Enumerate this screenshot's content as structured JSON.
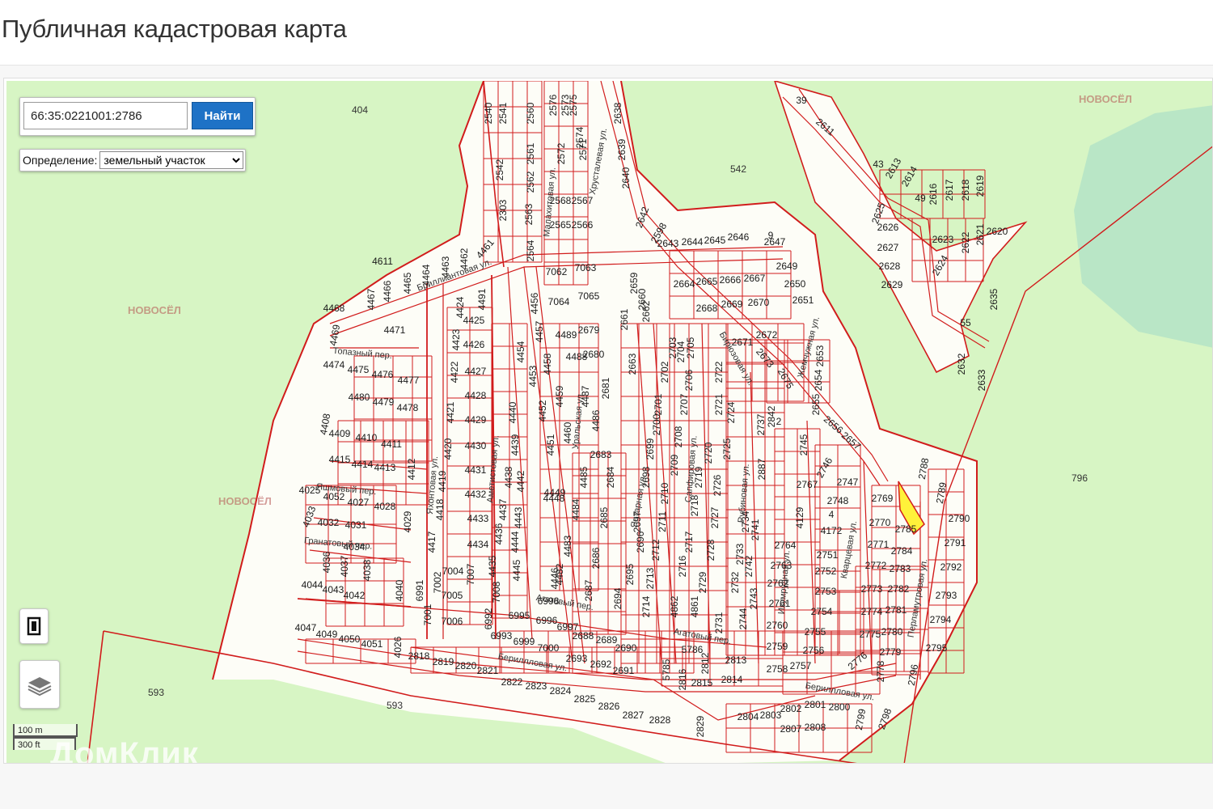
{
  "page": {
    "title": "Публичная кадастровая карта"
  },
  "search": {
    "value": "66:35:0221001:2786",
    "button_label": "Найти"
  },
  "definition": {
    "label": "Определение:",
    "selected": "земельный участок"
  },
  "scale": {
    "metric": "100 m",
    "imperial": "300 ft"
  },
  "watermarks": {
    "domclick": "ДомКлик",
    "novosel": "НОВОСЁЛ"
  },
  "colors": {
    "boundary": "#d11c1c",
    "land": "#d7f5c4",
    "built_area": "#ffffff",
    "selected_parcel": "#fff23a",
    "button": "#1e72c6"
  },
  "icons": {
    "fullscreen": "fullscreen-icon",
    "layers": "layers-icon",
    "search": "search-button"
  },
  "map": {
    "area_labels": [
      "404",
      "542",
      "796",
      "593",
      "593"
    ],
    "street_labels": [
      "Бриллиантовая ул.",
      "Топазный пер.",
      "Яшмовый пер.",
      "Гранатовый пер.",
      "Агатовый пер.",
      "Агатовый пер.",
      "Бериллловая ул.",
      "Бериллловая ул.",
      "Бирюзовая ул.",
      "Кварцевая ул.",
      "Перламутровая ул.",
      "Жемчужная ул.",
      "Хрусталевая ул.",
      "Малахитовая ул.",
      "Янтарная ул.",
      "Сапфировая ул.",
      "Рубиновая ул.",
      "Аметистовая ул.",
      "Яхонтовая ул.",
      "Уральская ул.",
      "Изумрудная ул."
    ],
    "selected_parcel": "2786",
    "parcels": [
      "2540",
      "2541",
      "2542",
      "2303",
      "2560",
      "2561",
      "2562",
      "2563",
      "2564",
      "2576",
      "2573",
      "2572",
      "2575",
      "2574",
      "2571",
      "2568",
      "2567",
      "2565",
      "2566",
      "2638",
      "2639",
      "2640",
      "2642",
      "2598",
      "2643",
      "2644",
      "2645",
      "2646",
      "2647",
      "2649",
      "2650",
      "2651",
      "2664",
      "2665",
      "2666",
      "2667",
      "2668",
      "2669",
      "2670",
      "2671",
      "2672",
      "2673",
      "2675",
      "2653",
      "2654",
      "2655",
      "2656",
      "2657",
      "2659",
      "2660",
      "2661",
      "2662",
      "2663",
      "2679",
      "2680",
      "2681",
      "2683",
      "2684",
      "2685",
      "2686",
      "2687",
      "2688",
      "2689",
      "2690",
      "2691",
      "2692",
      "2693",
      "2694",
      "2695",
      "2696",
      "2697",
      "2698",
      "2699",
      "2700",
      "2701",
      "2702",
      "2703",
      "2704",
      "2705",
      "2706",
      "2707",
      "2708",
      "2709",
      "2710",
      "2711",
      "2712",
      "2713",
      "2714",
      "2716",
      "2717",
      "2718",
      "2719",
      "2720",
      "2721",
      "2722",
      "2724",
      "2725",
      "2726",
      "2727",
      "2728",
      "2729",
      "2731",
      "2732",
      "2733",
      "2734",
      "2737",
      "2741",
      "2742",
      "2743",
      "2744",
      "2745",
      "2746",
      "2747",
      "2748",
      "2751",
      "2752",
      "2753",
      "2754",
      "2755",
      "2756",
      "2757",
      "2758",
      "2759",
      "2760",
      "2761",
      "2762",
      "2763",
      "2764",
      "2767",
      "2769",
      "2770",
      "2771",
      "2772",
      "2773",
      "2774",
      "2775",
      "2776",
      "2778",
      "2779",
      "2780",
      "2781",
      "2782",
      "2783",
      "2784",
      "2785",
      "2788",
      "2789",
      "2790",
      "2791",
      "2792",
      "2793",
      "2794",
      "2795",
      "2796",
      "2798",
      "2799",
      "2800",
      "2801",
      "2802",
      "2803",
      "2804",
      "2807",
      "2808",
      "2812",
      "2813",
      "2814",
      "2815",
      "2816",
      "2818",
      "2819",
      "2820",
      "2821",
      "2822",
      "2823",
      "2824",
      "2825",
      "2826",
      "2827",
      "2828",
      "2829",
      "2842",
      "2887",
      "4129",
      "4172",
      "4861",
      "4862",
      "5785",
      "5786",
      "2611",
      "2613",
      "2614",
      "2616",
      "2617",
      "2618",
      "2619",
      "2620",
      "2621",
      "2622",
      "2623",
      "2624",
      "2625",
      "2626",
      "2627",
      "2628",
      "2629",
      "2632",
      "2633",
      "2635",
      "4025",
      "4026",
      "4027",
      "4028",
      "4029",
      "4031",
      "4032",
      "4033",
      "4034",
      "4036",
      "4037",
      "4038",
      "4040",
      "4042",
      "4043",
      "4044",
      "4047",
      "4049",
      "4050",
      "4051",
      "4052",
      "4408",
      "4409",
      "4410",
      "4411",
      "4412",
      "4413",
      "4414",
      "4415",
      "4417",
      "4418",
      "4419",
      "4420",
      "4421",
      "4422",
      "4423",
      "4424",
      "4425",
      "4426",
      "4427",
      "4428",
      "4429",
      "4430",
      "4431",
      "4432",
      "4433",
      "4434",
      "4435",
      "4436",
      "4437",
      "4438",
      "4439",
      "4440",
      "4442",
      "4443",
      "4444",
      "4445",
      "4446",
      "4448",
      "4449",
      "4451",
      "4452",
      "4453",
      "4454",
      "4456",
      "4457",
      "4458",
      "4459",
      "4460",
      "4461",
      "4462",
      "4463",
      "4464",
      "4465",
      "4466",
      "4467",
      "4468",
      "4469",
      "4471",
      "4474",
      "4475",
      "4476",
      "4477",
      "4478",
      "4479",
      "4480",
      "4482",
      "4483",
      "4484",
      "4485",
      "4486",
      "4487",
      "4488",
      "4489",
      "4491",
      "4611",
      "6991",
      "6992",
      "6993",
      "6995",
      "6996",
      "6997",
      "6998",
      "6999",
      "7000",
      "7001",
      "7002",
      "7004",
      "7005",
      "7006",
      "7007",
      "7008",
      "7062",
      "7063",
      "7064",
      "7065",
      "39",
      "43",
      "49",
      "55",
      "9",
      "2",
      "4"
    ]
  }
}
